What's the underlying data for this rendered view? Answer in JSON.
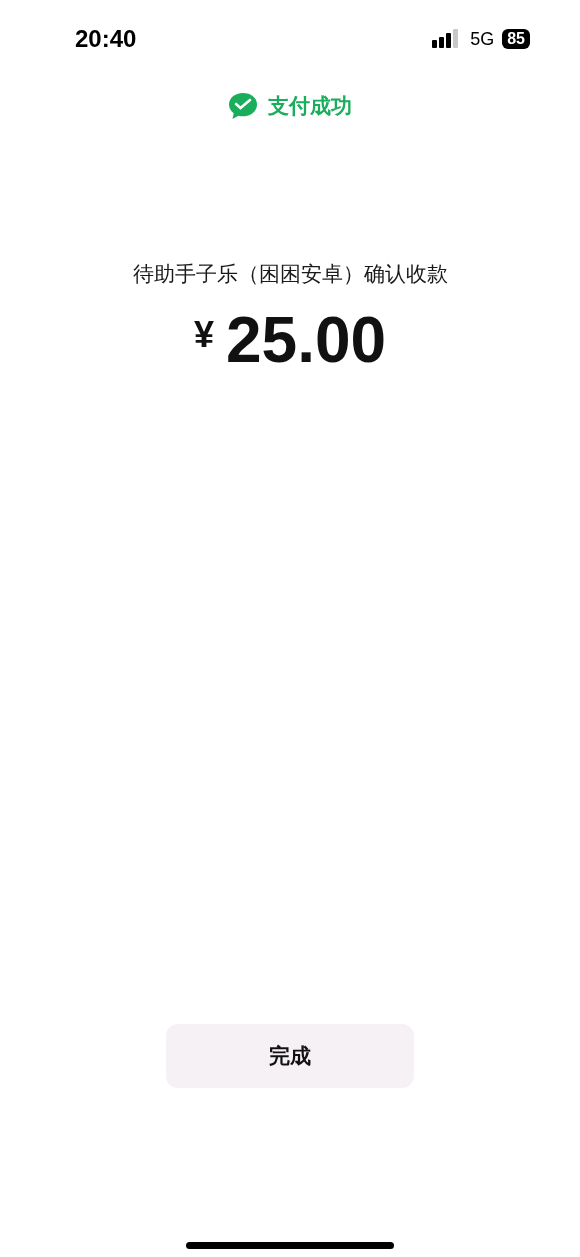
{
  "status_bar": {
    "time": "20:40",
    "network": "5G",
    "battery": "85"
  },
  "header": {
    "title": "支付成功"
  },
  "payment": {
    "payee": "待助手子乐（困困安卓）确认收款",
    "currency": "¥",
    "amount": "25.00"
  },
  "done_button": {
    "label": "完成"
  }
}
